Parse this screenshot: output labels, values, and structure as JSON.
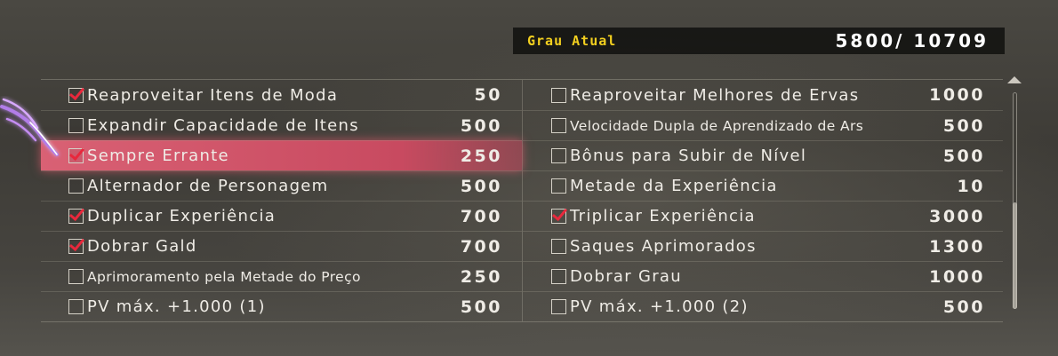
{
  "grade": {
    "label": "Grau Atual",
    "value": "5800/ 10709"
  },
  "left": [
    {
      "name": "Reaproveitar Itens de Moda",
      "cost": "50",
      "checked": true
    },
    {
      "name": "Expandir Capacidade de Itens",
      "cost": "500",
      "checked": false
    },
    {
      "name": "Sempre Errante",
      "cost": "250",
      "checked": true
    },
    {
      "name": "Alternador de Personagem",
      "cost": "500",
      "checked": false
    },
    {
      "name": "Duplicar Experiência",
      "cost": "700",
      "checked": true
    },
    {
      "name": "Dobrar Gald",
      "cost": "700",
      "checked": true
    },
    {
      "name": "Aprimoramento pela Metade do Preço",
      "cost": "250",
      "checked": false
    },
    {
      "name": "PV máx. +1.000 (1)",
      "cost": "500",
      "checked": false
    }
  ],
  "right": [
    {
      "name": "Reaproveitar Melhores de Ervas",
      "cost": "1000",
      "checked": false
    },
    {
      "name": "Velocidade Dupla de Aprendizado de Ars",
      "cost": "500",
      "checked": false
    },
    {
      "name": "Bônus para Subir de Nível",
      "cost": "500",
      "checked": false
    },
    {
      "name": "Metade da Experiência",
      "cost": "10",
      "checked": false
    },
    {
      "name": "Triplicar Experiência",
      "cost": "3000",
      "checked": true
    },
    {
      "name": "Saques Aprimorados",
      "cost": "1300",
      "checked": false
    },
    {
      "name": "Dobrar Grau",
      "cost": "1000",
      "checked": false
    },
    {
      "name": "PV máx. +1.000 (2)",
      "cost": "500",
      "checked": false
    }
  ],
  "selected_row": "Sempre Errante",
  "colors": {
    "accent": "#f2cf1f",
    "selection": "#d96174",
    "check": "#e8283c"
  }
}
